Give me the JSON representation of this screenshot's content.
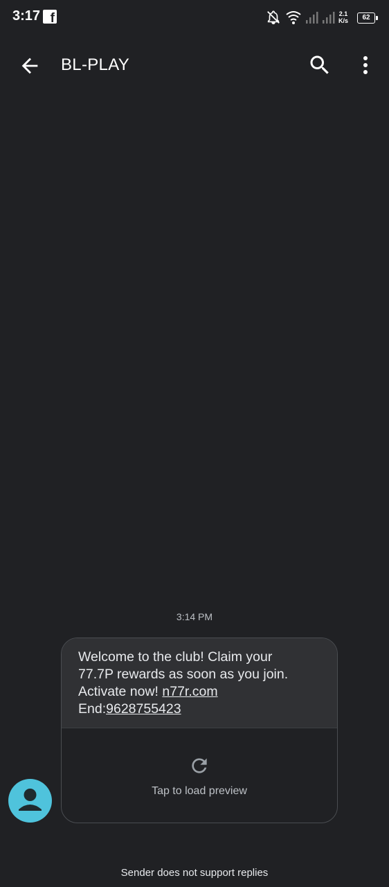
{
  "status_bar": {
    "time": "3:17",
    "app_icon": "facebook-icon",
    "icons": [
      "notification-off-icon",
      "wifi-icon",
      "signal-icon",
      "signal-icon"
    ],
    "net_speed_value": "2.1",
    "net_speed_unit": "K/s",
    "battery_level": "62"
  },
  "toolbar": {
    "title": "BL-PLAY",
    "back_icon": "arrow-left-icon",
    "search_icon": "search-icon",
    "more_icon": "more-vertical-icon"
  },
  "conversation": {
    "timestamp": "3:14 PM",
    "message": {
      "line1": "Welcome to the club! Claim your",
      "line2": "77.7P rewards as soon as you join.",
      "line3_prefix": "Activate now! ",
      "link": "n77r.com",
      "line4_prefix": "End:",
      "phone": "9628755423"
    },
    "preview": {
      "icon": "refresh-icon",
      "label": "Tap to load preview"
    },
    "avatar_color": "#4fc3dc"
  },
  "footer": {
    "note": "Sender does not support replies"
  },
  "colors": {
    "background": "#202124",
    "bubble": "#303134",
    "accent": "#4fc3dc"
  }
}
